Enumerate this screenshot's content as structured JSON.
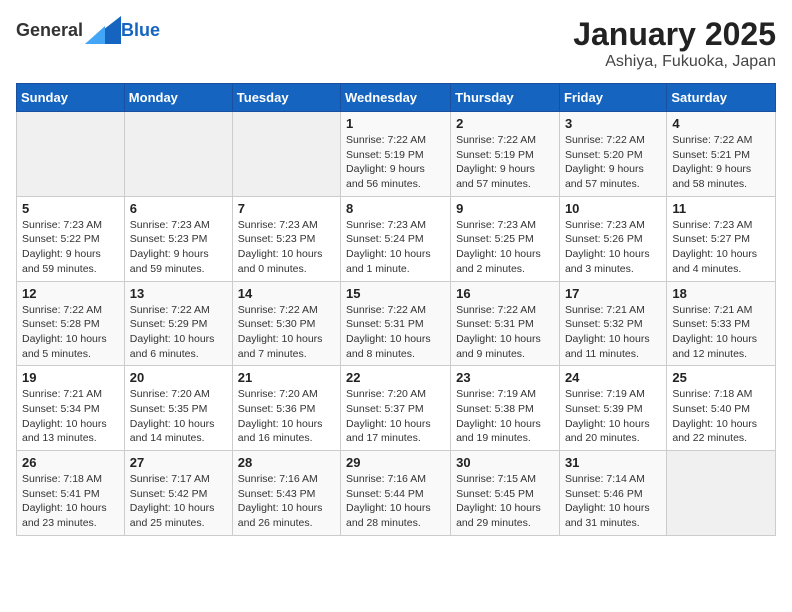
{
  "header": {
    "logo": {
      "general": "General",
      "blue": "Blue"
    },
    "title": "January 2025",
    "subtitle": "Ashiya, Fukuoka, Japan"
  },
  "weekdays": [
    "Sunday",
    "Monday",
    "Tuesday",
    "Wednesday",
    "Thursday",
    "Friday",
    "Saturday"
  ],
  "weeks": [
    [
      {
        "day": "",
        "detail": ""
      },
      {
        "day": "",
        "detail": ""
      },
      {
        "day": "",
        "detail": ""
      },
      {
        "day": "1",
        "detail": "Sunrise: 7:22 AM\nSunset: 5:19 PM\nDaylight: 9 hours and 56 minutes."
      },
      {
        "day": "2",
        "detail": "Sunrise: 7:22 AM\nSunset: 5:19 PM\nDaylight: 9 hours and 57 minutes."
      },
      {
        "day": "3",
        "detail": "Sunrise: 7:22 AM\nSunset: 5:20 PM\nDaylight: 9 hours and 57 minutes."
      },
      {
        "day": "4",
        "detail": "Sunrise: 7:22 AM\nSunset: 5:21 PM\nDaylight: 9 hours and 58 minutes."
      }
    ],
    [
      {
        "day": "5",
        "detail": "Sunrise: 7:23 AM\nSunset: 5:22 PM\nDaylight: 9 hours and 59 minutes."
      },
      {
        "day": "6",
        "detail": "Sunrise: 7:23 AM\nSunset: 5:23 PM\nDaylight: 9 hours and 59 minutes."
      },
      {
        "day": "7",
        "detail": "Sunrise: 7:23 AM\nSunset: 5:23 PM\nDaylight: 10 hours and 0 minutes."
      },
      {
        "day": "8",
        "detail": "Sunrise: 7:23 AM\nSunset: 5:24 PM\nDaylight: 10 hours and 1 minute."
      },
      {
        "day": "9",
        "detail": "Sunrise: 7:23 AM\nSunset: 5:25 PM\nDaylight: 10 hours and 2 minutes."
      },
      {
        "day": "10",
        "detail": "Sunrise: 7:23 AM\nSunset: 5:26 PM\nDaylight: 10 hours and 3 minutes."
      },
      {
        "day": "11",
        "detail": "Sunrise: 7:23 AM\nSunset: 5:27 PM\nDaylight: 10 hours and 4 minutes."
      }
    ],
    [
      {
        "day": "12",
        "detail": "Sunrise: 7:22 AM\nSunset: 5:28 PM\nDaylight: 10 hours and 5 minutes."
      },
      {
        "day": "13",
        "detail": "Sunrise: 7:22 AM\nSunset: 5:29 PM\nDaylight: 10 hours and 6 minutes."
      },
      {
        "day": "14",
        "detail": "Sunrise: 7:22 AM\nSunset: 5:30 PM\nDaylight: 10 hours and 7 minutes."
      },
      {
        "day": "15",
        "detail": "Sunrise: 7:22 AM\nSunset: 5:31 PM\nDaylight: 10 hours and 8 minutes."
      },
      {
        "day": "16",
        "detail": "Sunrise: 7:22 AM\nSunset: 5:31 PM\nDaylight: 10 hours and 9 minutes."
      },
      {
        "day": "17",
        "detail": "Sunrise: 7:21 AM\nSunset: 5:32 PM\nDaylight: 10 hours and 11 minutes."
      },
      {
        "day": "18",
        "detail": "Sunrise: 7:21 AM\nSunset: 5:33 PM\nDaylight: 10 hours and 12 minutes."
      }
    ],
    [
      {
        "day": "19",
        "detail": "Sunrise: 7:21 AM\nSunset: 5:34 PM\nDaylight: 10 hours and 13 minutes."
      },
      {
        "day": "20",
        "detail": "Sunrise: 7:20 AM\nSunset: 5:35 PM\nDaylight: 10 hours and 14 minutes."
      },
      {
        "day": "21",
        "detail": "Sunrise: 7:20 AM\nSunset: 5:36 PM\nDaylight: 10 hours and 16 minutes."
      },
      {
        "day": "22",
        "detail": "Sunrise: 7:20 AM\nSunset: 5:37 PM\nDaylight: 10 hours and 17 minutes."
      },
      {
        "day": "23",
        "detail": "Sunrise: 7:19 AM\nSunset: 5:38 PM\nDaylight: 10 hours and 19 minutes."
      },
      {
        "day": "24",
        "detail": "Sunrise: 7:19 AM\nSunset: 5:39 PM\nDaylight: 10 hours and 20 minutes."
      },
      {
        "day": "25",
        "detail": "Sunrise: 7:18 AM\nSunset: 5:40 PM\nDaylight: 10 hours and 22 minutes."
      }
    ],
    [
      {
        "day": "26",
        "detail": "Sunrise: 7:18 AM\nSunset: 5:41 PM\nDaylight: 10 hours and 23 minutes."
      },
      {
        "day": "27",
        "detail": "Sunrise: 7:17 AM\nSunset: 5:42 PM\nDaylight: 10 hours and 25 minutes."
      },
      {
        "day": "28",
        "detail": "Sunrise: 7:16 AM\nSunset: 5:43 PM\nDaylight: 10 hours and 26 minutes."
      },
      {
        "day": "29",
        "detail": "Sunrise: 7:16 AM\nSunset: 5:44 PM\nDaylight: 10 hours and 28 minutes."
      },
      {
        "day": "30",
        "detail": "Sunrise: 7:15 AM\nSunset: 5:45 PM\nDaylight: 10 hours and 29 minutes."
      },
      {
        "day": "31",
        "detail": "Sunrise: 7:14 AM\nSunset: 5:46 PM\nDaylight: 10 hours and 31 minutes."
      },
      {
        "day": "",
        "detail": ""
      }
    ]
  ]
}
